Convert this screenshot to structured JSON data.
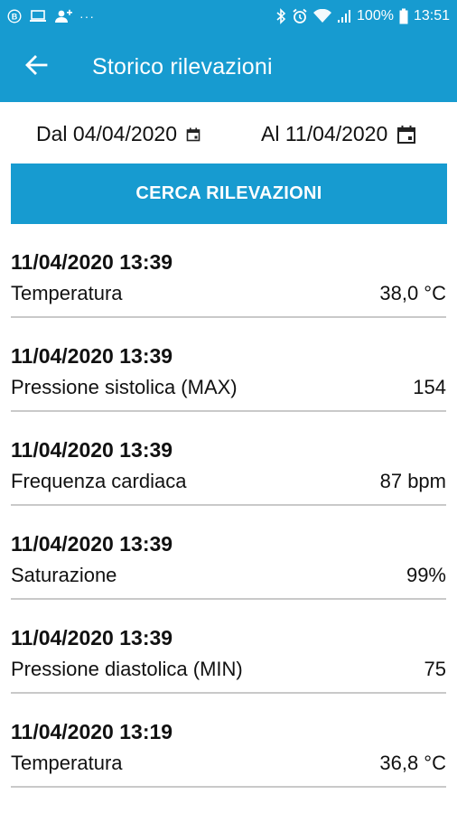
{
  "status_bar": {
    "battery_text": "100%",
    "time": "13:51",
    "overflow": "···"
  },
  "header": {
    "title": "Storico rilevazioni"
  },
  "filters": {
    "from_label": "Dal 04/04/2020",
    "to_label": "Al 11/04/2020"
  },
  "search_button": {
    "label": "CERCA RILEVAZIONI"
  },
  "readings": [
    {
      "datetime": "11/04/2020 13:39",
      "name": "Temperatura",
      "value": "38,0 °C"
    },
    {
      "datetime": "11/04/2020 13:39",
      "name": "Pressione sistolica (MAX)",
      "value": "154"
    },
    {
      "datetime": "11/04/2020 13:39",
      "name": "Frequenza cardiaca",
      "value": "87 bpm"
    },
    {
      "datetime": "11/04/2020 13:39",
      "name": "Saturazione",
      "value": "99%"
    },
    {
      "datetime": "11/04/2020 13:39",
      "name": "Pressione diastolica (MIN)",
      "value": "75"
    },
    {
      "datetime": "11/04/2020 13:19",
      "name": "Temperatura",
      "value": "36,8 °C"
    }
  ],
  "colors": {
    "primary": "#179bd0",
    "divider": "#c9c9c9"
  },
  "icons": {
    "status_left": [
      "b-circle-icon",
      "laptop-icon",
      "person-add-icon"
    ],
    "status_right": [
      "bluetooth-icon",
      "alarm-icon",
      "wifi-icon",
      "signal-icon",
      "battery-icon"
    ],
    "back": "arrow-left-icon",
    "calendar": "calendar-icon"
  }
}
